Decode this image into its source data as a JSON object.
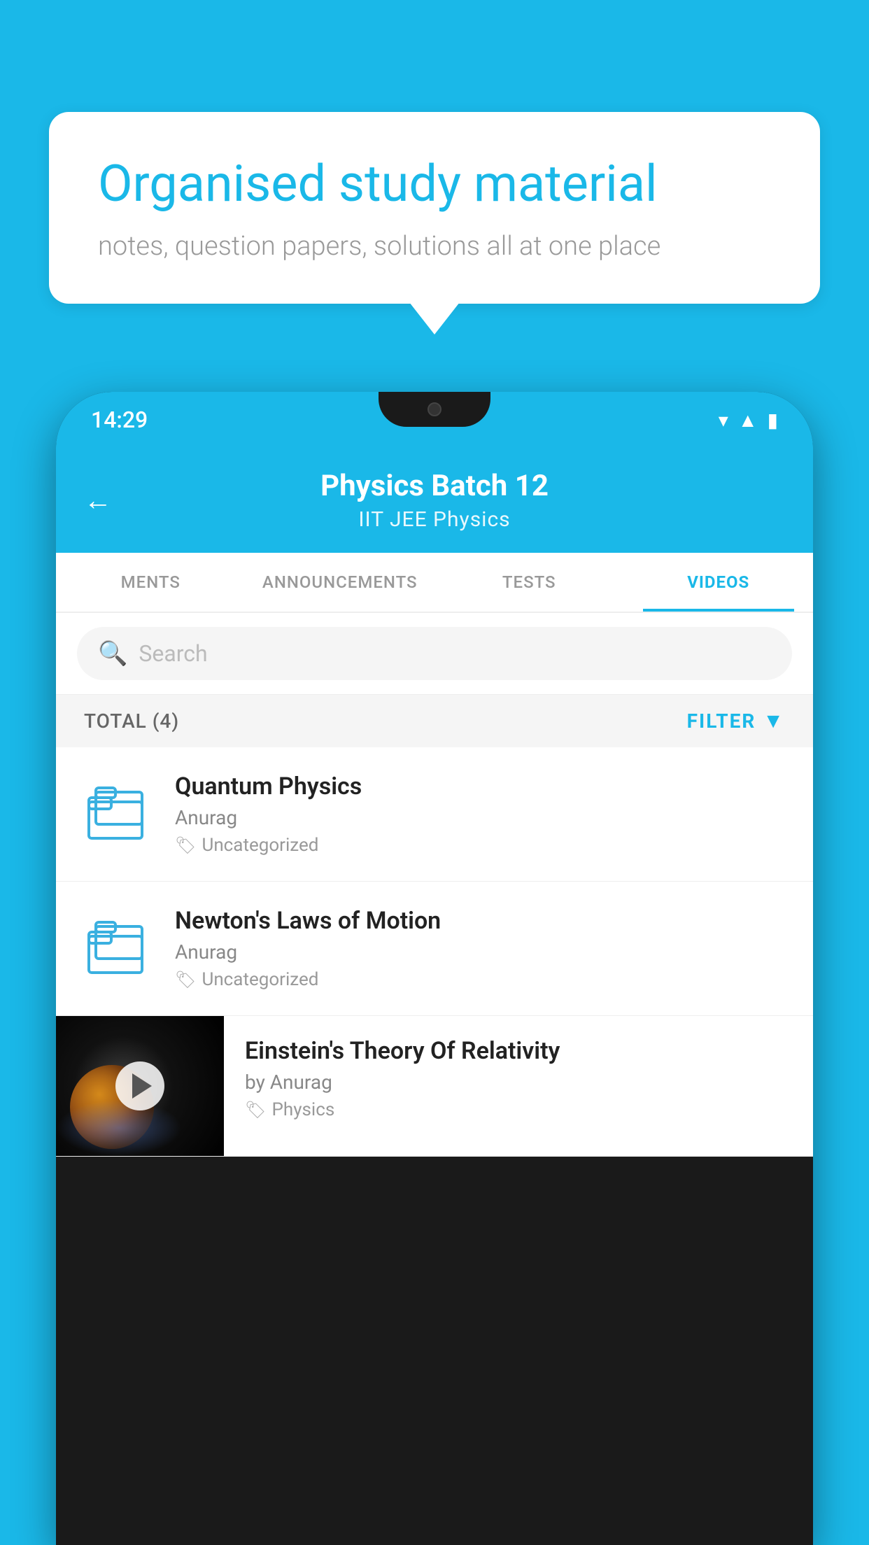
{
  "page": {
    "background_color": "#1ab8e8"
  },
  "speech_bubble": {
    "title": "Organised study material",
    "subtitle": "notes, question papers, solutions all at one place"
  },
  "phone": {
    "status_bar": {
      "time": "14:29"
    },
    "app_header": {
      "back_label": "←",
      "title": "Physics Batch 12",
      "subtitle": "IIT JEE    Physics"
    },
    "tabs": [
      {
        "label": "MENTS",
        "active": false
      },
      {
        "label": "ANNOUNCEMENTS",
        "active": false
      },
      {
        "label": "TESTS",
        "active": false
      },
      {
        "label": "VIDEOS",
        "active": true
      }
    ],
    "search": {
      "placeholder": "Search"
    },
    "filter_bar": {
      "total_label": "TOTAL (4)",
      "filter_label": "FILTER"
    },
    "video_items": [
      {
        "title": "Quantum Physics",
        "author": "Anurag",
        "tag": "Uncategorized",
        "has_thumb": false
      },
      {
        "title": "Newton's Laws of Motion",
        "author": "Anurag",
        "tag": "Uncategorized",
        "has_thumb": false
      },
      {
        "title": "Einstein's Theory Of Relativity",
        "author": "by Anurag",
        "tag": "Physics",
        "has_thumb": true
      }
    ]
  }
}
